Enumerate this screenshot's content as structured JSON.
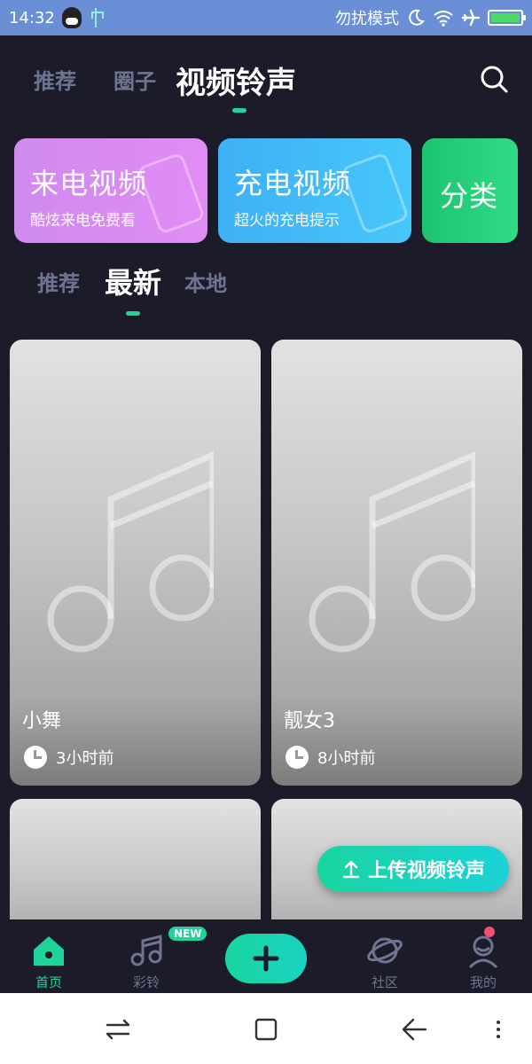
{
  "status_bar": {
    "time": "14:32",
    "dnd_label": "勿扰模式",
    "icons": [
      "qq-icon",
      "usb-icon",
      "moon-icon",
      "wifi-icon",
      "airplane-icon",
      "battery-icon"
    ]
  },
  "top_tabs": {
    "items": [
      "推荐",
      "圈子",
      "视频铃声"
    ],
    "active": "视频铃声"
  },
  "category_cards": [
    {
      "title": "来电视频",
      "subtitle": "酷炫来电免费看",
      "color": "#d98af2"
    },
    {
      "title": "充电视频",
      "subtitle": "超火的充电提示",
      "color": "#43bdf8"
    },
    {
      "title": "分类",
      "color": "#25d07a"
    }
  ],
  "sub_tabs": {
    "items": [
      "推荐",
      "最新",
      "本地"
    ],
    "active": "最新"
  },
  "videos": [
    {
      "name": "小舞",
      "time": "3小时前"
    },
    {
      "name": "靓女3",
      "time": "8小时前"
    },
    {
      "name": "",
      "time": ""
    },
    {
      "name": "",
      "time": ""
    }
  ],
  "upload_button": {
    "label": "上传视频铃声"
  },
  "bottom_nav": {
    "items": [
      {
        "label": "首页",
        "icon": "home-icon",
        "active": true
      },
      {
        "label": "彩铃",
        "icon": "music-note-icon",
        "badge": "NEW"
      },
      {
        "label": "",
        "icon": "plus-icon"
      },
      {
        "label": "社区",
        "icon": "planet-icon"
      },
      {
        "label": "我的",
        "icon": "person-icon"
      }
    ]
  },
  "colors": {
    "background": "#1b1b29",
    "accent": "#1fd39b",
    "inactive_text": "#6d7590",
    "status_bar": "#6b8fd6"
  }
}
